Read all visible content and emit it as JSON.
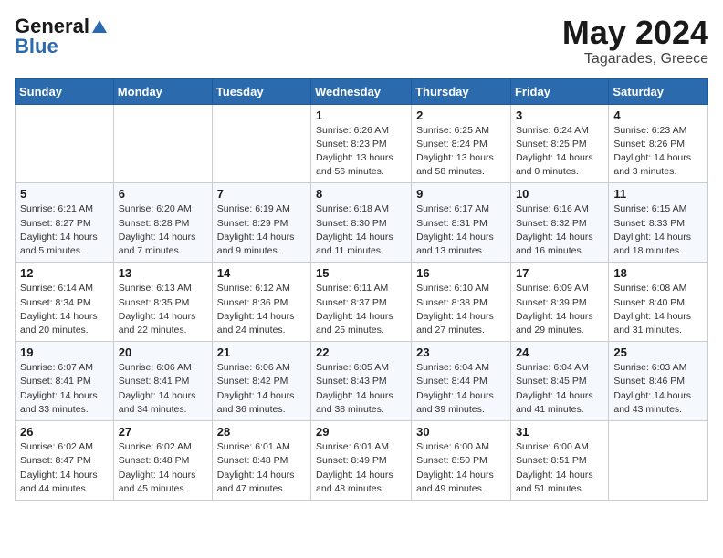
{
  "logo": {
    "general": "General",
    "blue": "Blue"
  },
  "title": {
    "month_year": "May 2024",
    "location": "Tagarades, Greece"
  },
  "header_days": [
    "Sunday",
    "Monday",
    "Tuesday",
    "Wednesday",
    "Thursday",
    "Friday",
    "Saturday"
  ],
  "weeks": [
    [
      {
        "day": "",
        "info": ""
      },
      {
        "day": "",
        "info": ""
      },
      {
        "day": "",
        "info": ""
      },
      {
        "day": "1",
        "info": "Sunrise: 6:26 AM\nSunset: 8:23 PM\nDaylight: 13 hours\nand 56 minutes."
      },
      {
        "day": "2",
        "info": "Sunrise: 6:25 AM\nSunset: 8:24 PM\nDaylight: 13 hours\nand 58 minutes."
      },
      {
        "day": "3",
        "info": "Sunrise: 6:24 AM\nSunset: 8:25 PM\nDaylight: 14 hours\nand 0 minutes."
      },
      {
        "day": "4",
        "info": "Sunrise: 6:23 AM\nSunset: 8:26 PM\nDaylight: 14 hours\nand 3 minutes."
      }
    ],
    [
      {
        "day": "5",
        "info": "Sunrise: 6:21 AM\nSunset: 8:27 PM\nDaylight: 14 hours\nand 5 minutes."
      },
      {
        "day": "6",
        "info": "Sunrise: 6:20 AM\nSunset: 8:28 PM\nDaylight: 14 hours\nand 7 minutes."
      },
      {
        "day": "7",
        "info": "Sunrise: 6:19 AM\nSunset: 8:29 PM\nDaylight: 14 hours\nand 9 minutes."
      },
      {
        "day": "8",
        "info": "Sunrise: 6:18 AM\nSunset: 8:30 PM\nDaylight: 14 hours\nand 11 minutes."
      },
      {
        "day": "9",
        "info": "Sunrise: 6:17 AM\nSunset: 8:31 PM\nDaylight: 14 hours\nand 13 minutes."
      },
      {
        "day": "10",
        "info": "Sunrise: 6:16 AM\nSunset: 8:32 PM\nDaylight: 14 hours\nand 16 minutes."
      },
      {
        "day": "11",
        "info": "Sunrise: 6:15 AM\nSunset: 8:33 PM\nDaylight: 14 hours\nand 18 minutes."
      }
    ],
    [
      {
        "day": "12",
        "info": "Sunrise: 6:14 AM\nSunset: 8:34 PM\nDaylight: 14 hours\nand 20 minutes."
      },
      {
        "day": "13",
        "info": "Sunrise: 6:13 AM\nSunset: 8:35 PM\nDaylight: 14 hours\nand 22 minutes."
      },
      {
        "day": "14",
        "info": "Sunrise: 6:12 AM\nSunset: 8:36 PM\nDaylight: 14 hours\nand 24 minutes."
      },
      {
        "day": "15",
        "info": "Sunrise: 6:11 AM\nSunset: 8:37 PM\nDaylight: 14 hours\nand 25 minutes."
      },
      {
        "day": "16",
        "info": "Sunrise: 6:10 AM\nSunset: 8:38 PM\nDaylight: 14 hours\nand 27 minutes."
      },
      {
        "day": "17",
        "info": "Sunrise: 6:09 AM\nSunset: 8:39 PM\nDaylight: 14 hours\nand 29 minutes."
      },
      {
        "day": "18",
        "info": "Sunrise: 6:08 AM\nSunset: 8:40 PM\nDaylight: 14 hours\nand 31 minutes."
      }
    ],
    [
      {
        "day": "19",
        "info": "Sunrise: 6:07 AM\nSunset: 8:41 PM\nDaylight: 14 hours\nand 33 minutes."
      },
      {
        "day": "20",
        "info": "Sunrise: 6:06 AM\nSunset: 8:41 PM\nDaylight: 14 hours\nand 34 minutes."
      },
      {
        "day": "21",
        "info": "Sunrise: 6:06 AM\nSunset: 8:42 PM\nDaylight: 14 hours\nand 36 minutes."
      },
      {
        "day": "22",
        "info": "Sunrise: 6:05 AM\nSunset: 8:43 PM\nDaylight: 14 hours\nand 38 minutes."
      },
      {
        "day": "23",
        "info": "Sunrise: 6:04 AM\nSunset: 8:44 PM\nDaylight: 14 hours\nand 39 minutes."
      },
      {
        "day": "24",
        "info": "Sunrise: 6:04 AM\nSunset: 8:45 PM\nDaylight: 14 hours\nand 41 minutes."
      },
      {
        "day": "25",
        "info": "Sunrise: 6:03 AM\nSunset: 8:46 PM\nDaylight: 14 hours\nand 43 minutes."
      }
    ],
    [
      {
        "day": "26",
        "info": "Sunrise: 6:02 AM\nSunset: 8:47 PM\nDaylight: 14 hours\nand 44 minutes."
      },
      {
        "day": "27",
        "info": "Sunrise: 6:02 AM\nSunset: 8:48 PM\nDaylight: 14 hours\nand 45 minutes."
      },
      {
        "day": "28",
        "info": "Sunrise: 6:01 AM\nSunset: 8:48 PM\nDaylight: 14 hours\nand 47 minutes."
      },
      {
        "day": "29",
        "info": "Sunrise: 6:01 AM\nSunset: 8:49 PM\nDaylight: 14 hours\nand 48 minutes."
      },
      {
        "day": "30",
        "info": "Sunrise: 6:00 AM\nSunset: 8:50 PM\nDaylight: 14 hours\nand 49 minutes."
      },
      {
        "day": "31",
        "info": "Sunrise: 6:00 AM\nSunset: 8:51 PM\nDaylight: 14 hours\nand 51 minutes."
      },
      {
        "day": "",
        "info": ""
      }
    ]
  ]
}
